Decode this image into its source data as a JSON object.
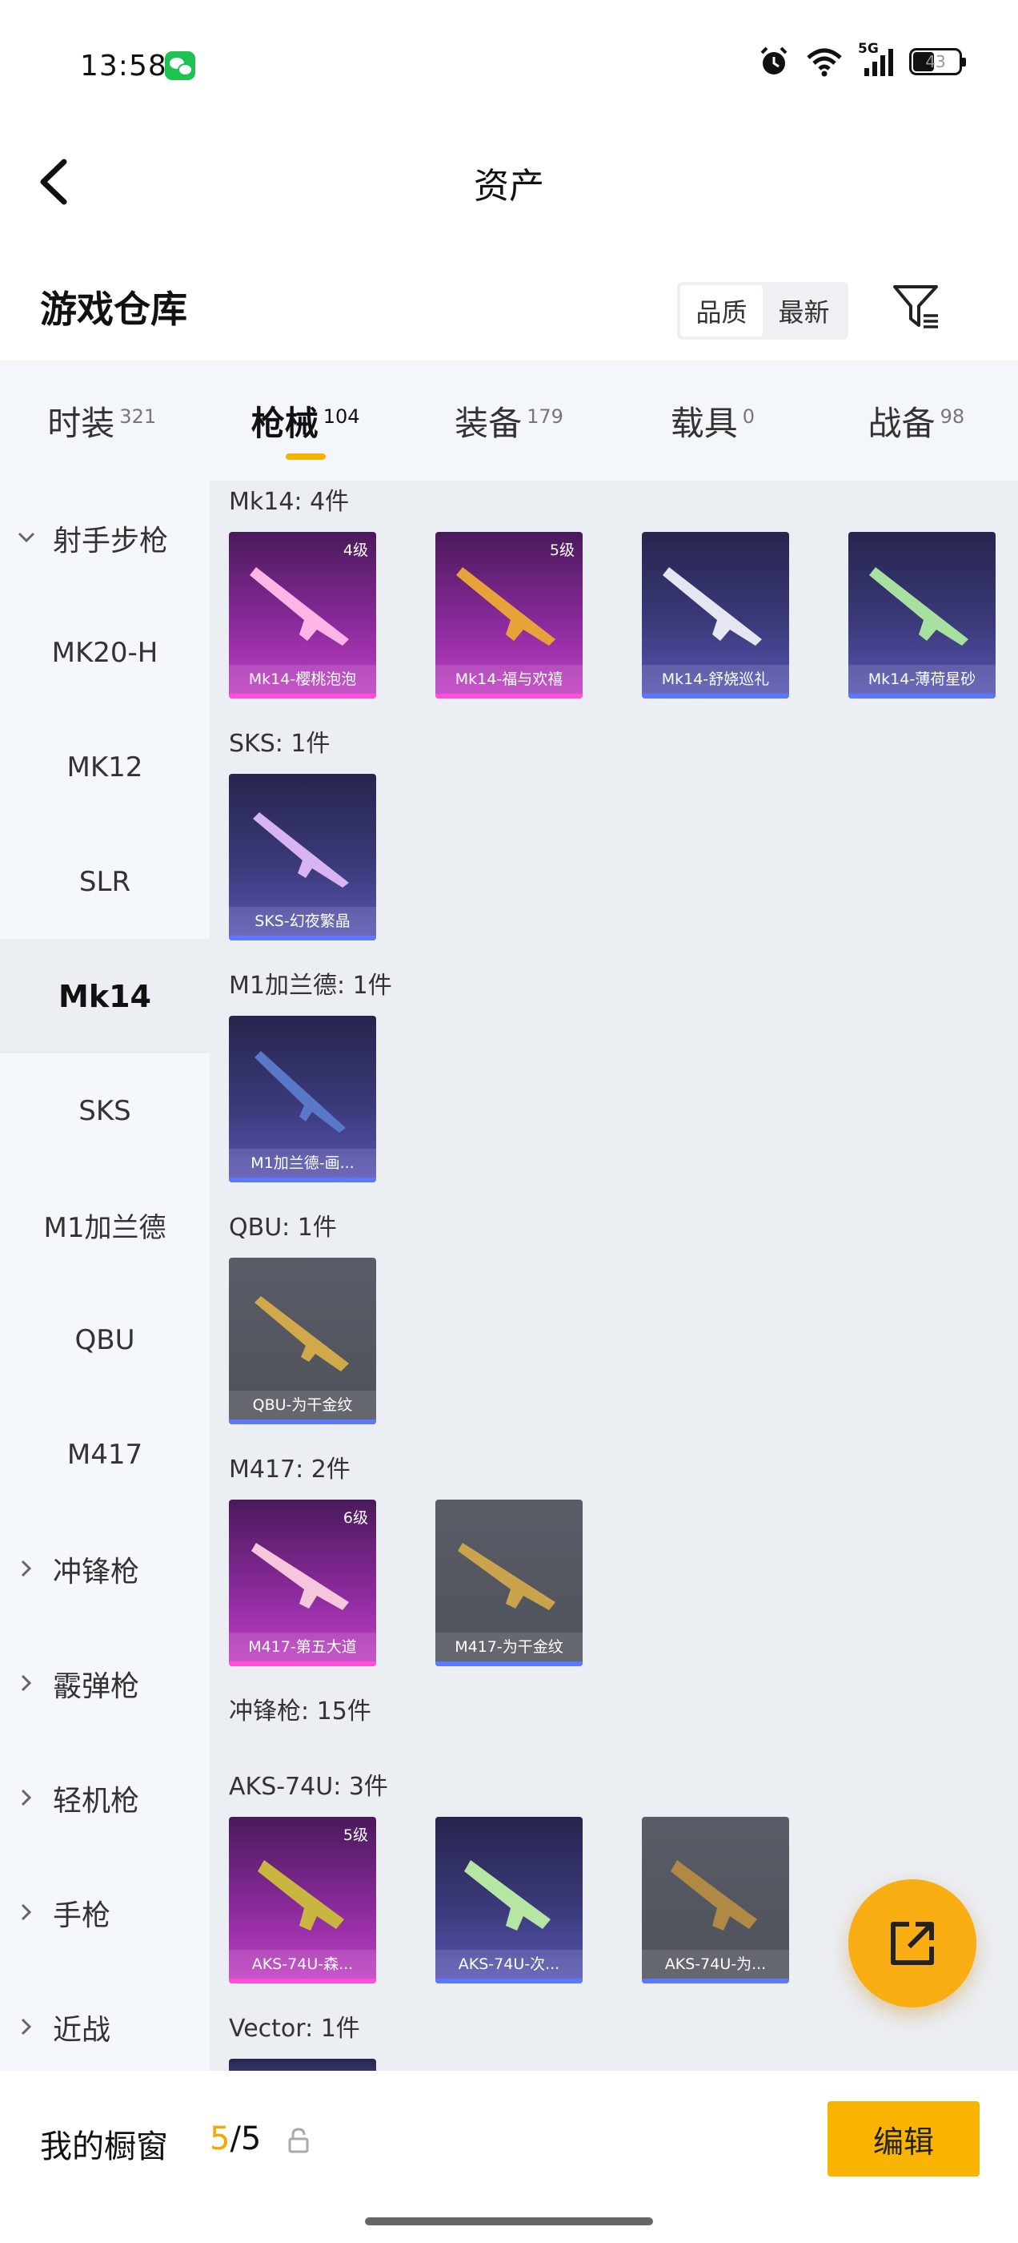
{
  "status_bar": {
    "time": "13:58",
    "signal_label": "5G",
    "battery": "43",
    "battery_level": 0.43
  },
  "header": {
    "title": "资产"
  },
  "warehouse": {
    "title": "游戏仓库",
    "sort_options": [
      "品质",
      "最新"
    ],
    "active_sort": "品质"
  },
  "tabs": [
    {
      "label": "时装",
      "count": "321"
    },
    {
      "label": "枪械",
      "count": "104",
      "active": true
    },
    {
      "label": "装备",
      "count": "179"
    },
    {
      "label": "载具",
      "count": "0"
    },
    {
      "label": "战备",
      "count": "98"
    }
  ],
  "sidebar": [
    {
      "label": "射手步枪",
      "type": "group-open"
    },
    {
      "label": "MK20-H"
    },
    {
      "label": "MK12"
    },
    {
      "label": "SLR"
    },
    {
      "label": "Mk14",
      "active": true
    },
    {
      "label": "SKS"
    },
    {
      "label": "M1加兰德"
    },
    {
      "label": "QBU"
    },
    {
      "label": "M417"
    },
    {
      "label": "冲锋枪",
      "type": "group-closed"
    },
    {
      "label": "霰弹枪",
      "type": "group-closed"
    },
    {
      "label": "轻机枪",
      "type": "group-closed"
    },
    {
      "label": "手枪",
      "type": "group-closed"
    },
    {
      "label": "近战",
      "type": "group-closed"
    }
  ],
  "content": {
    "mk14": {
      "header": "Mk14: 4件",
      "items": [
        {
          "name": "Mk14-樱桃泡泡",
          "level": "4级",
          "rarity": "pink"
        },
        {
          "name": "Mk14-福与欢禧",
          "level": "5级",
          "rarity": "pink"
        },
        {
          "name": "Mk14-舒娆巡礼",
          "level": "",
          "rarity": "purple"
        },
        {
          "name": "Mk14-薄荷星砂",
          "level": "",
          "rarity": "purple"
        }
      ]
    },
    "sks": {
      "header": "SKS: 1件",
      "items": [
        {
          "name": "SKS-幻夜繁晶",
          "level": "",
          "rarity": "purple"
        }
      ]
    },
    "m1": {
      "header": "M1加兰德: 1件",
      "items": [
        {
          "name": "M1加兰德-画...",
          "level": "",
          "rarity": "purple"
        }
      ]
    },
    "qbu": {
      "header": "QBU: 1件",
      "items": [
        {
          "name": "QBU-为干金纹",
          "level": "",
          "rarity": "grey"
        }
      ]
    },
    "m417": {
      "header": "M417: 2件",
      "items": [
        {
          "name": "M417-第五大道",
          "level": "6级",
          "rarity": "pink"
        },
        {
          "name": "M417-为干金纹",
          "level": "",
          "rarity": "grey"
        }
      ]
    },
    "smg_header": "冲锋枪: 15件",
    "aks": {
      "header": "AKS-74U: 3件",
      "items": [
        {
          "name": "AKS-74U-森...",
          "level": "5级",
          "rarity": "pink"
        },
        {
          "name": "AKS-74U-次...",
          "level": "",
          "rarity": "purple"
        },
        {
          "name": "AKS-74U-为...",
          "level": "",
          "rarity": "grey"
        }
      ]
    },
    "vector_header": "Vector: 1件"
  },
  "bottom_bar": {
    "showcase_label": "我的橱窗",
    "showcase_current": "5",
    "showcase_total": "/5",
    "edit_label": "编辑"
  },
  "colors": {
    "accent": "#f8b400",
    "pink_rarity": "#c43fc6",
    "purple_rarity": "#5a56b6",
    "grey_rarity": "#595c66"
  }
}
